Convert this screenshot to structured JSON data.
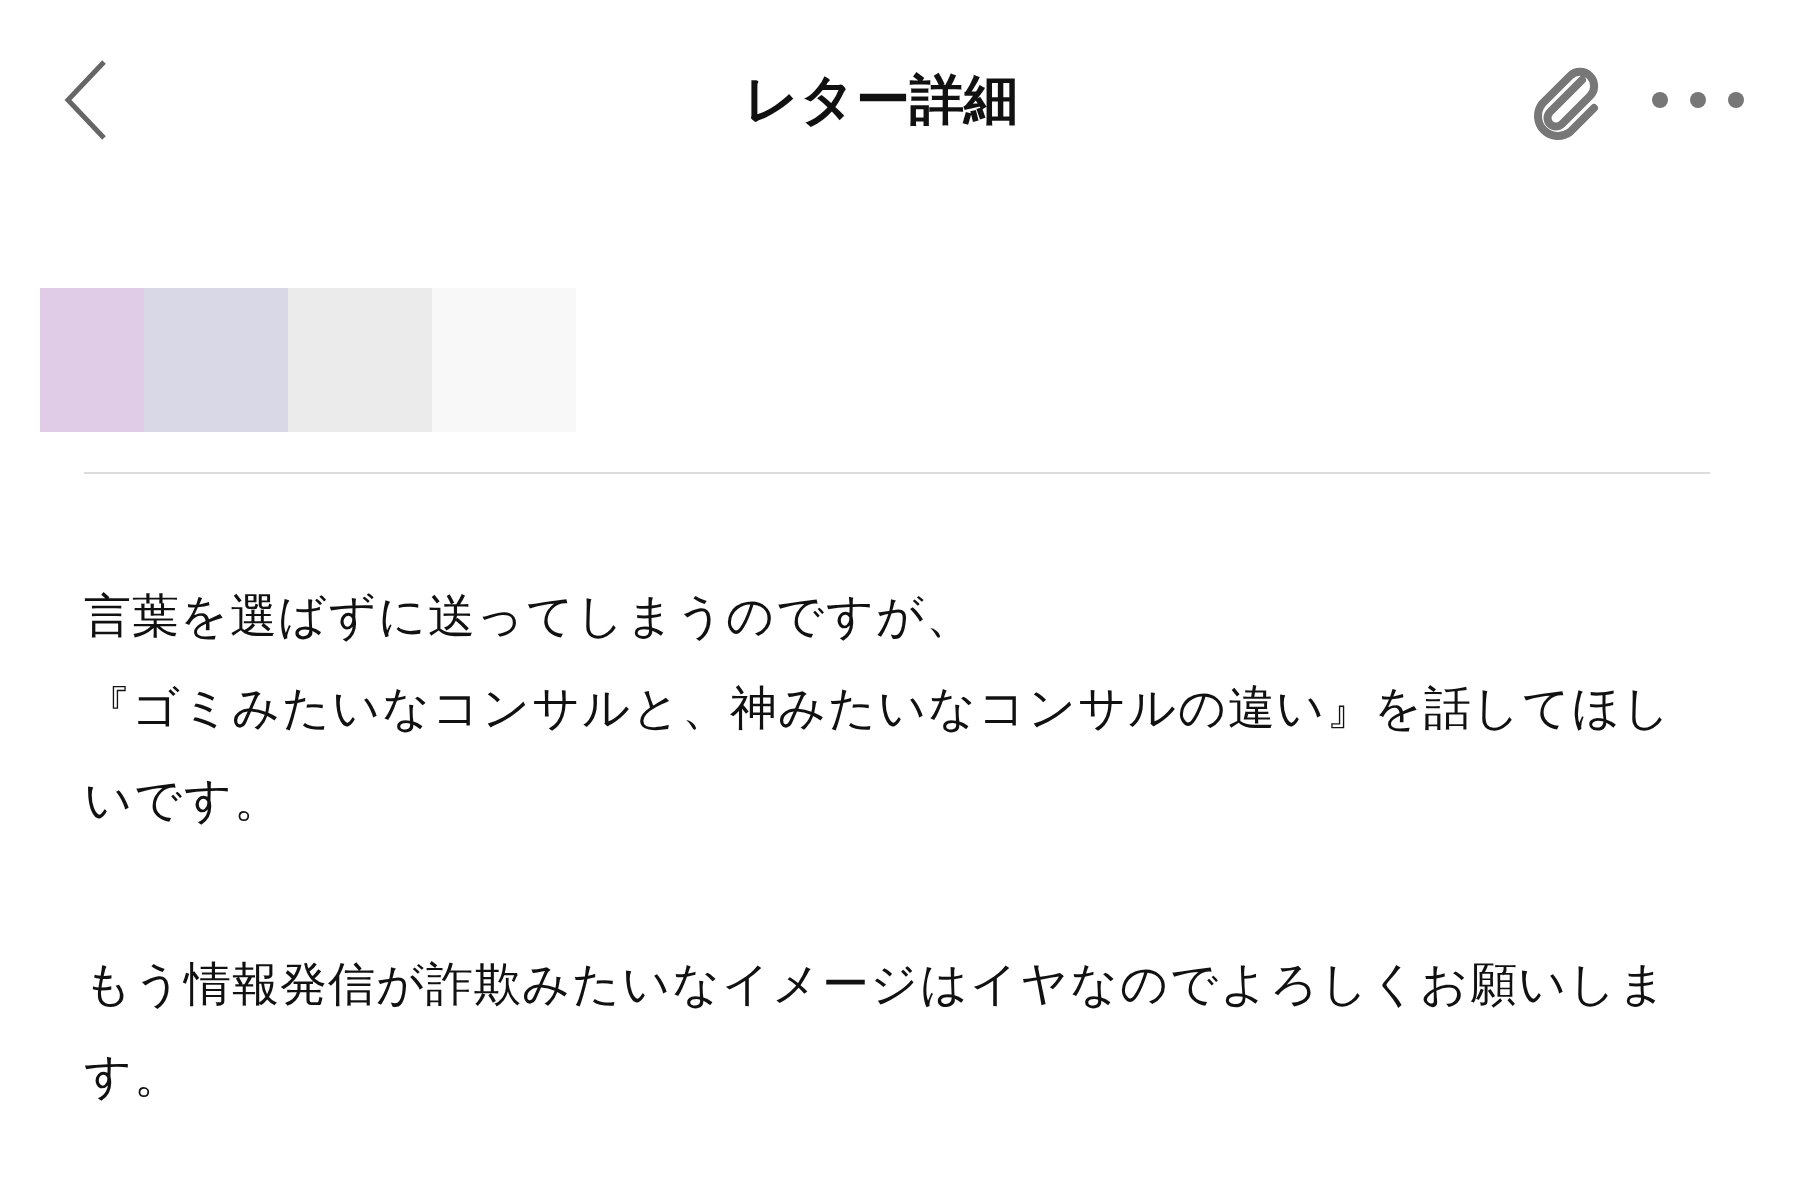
{
  "header": {
    "title": "レター詳細"
  },
  "body": {
    "paragraphs": [
      {
        "lines": [
          "言葉を選ばずに送ってしまうのですが、",
          "『ゴミみたいなコンサルと、神みたいなコンサルの違い』を話してほしいです。"
        ]
      },
      {
        "lines": [
          "もう情報発信が詐欺みたいなイメージはイヤなのでよろしくお願いします。"
        ]
      }
    ]
  }
}
